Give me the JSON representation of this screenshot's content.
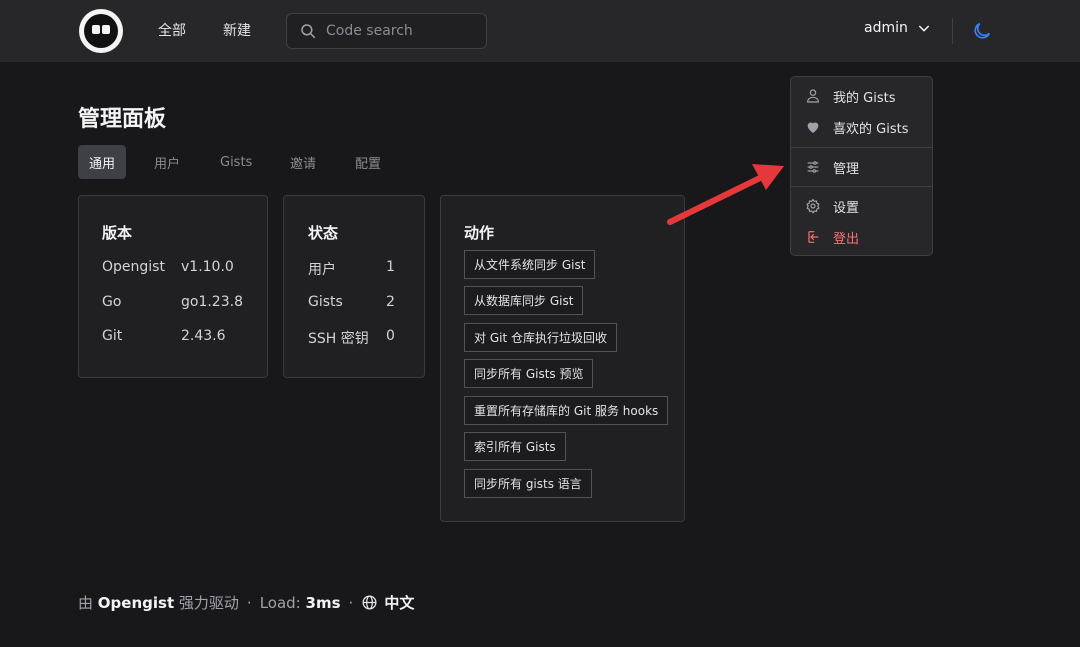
{
  "header": {
    "nav": [
      "全部",
      "新建"
    ],
    "search_placeholder": "Code search",
    "username": "admin"
  },
  "page": {
    "title": "管理面板",
    "tabs": [
      "通用",
      "用户",
      "Gists",
      "邀请",
      "配置"
    ]
  },
  "version_card": {
    "title": "版本",
    "rows": [
      {
        "label": "Opengist",
        "value": "v1.10.0"
      },
      {
        "label": "Go",
        "value": "go1.23.8"
      },
      {
        "label": "Git",
        "value": "2.43.6"
      }
    ]
  },
  "status_card": {
    "title": "状态",
    "rows": [
      {
        "label": "用户",
        "value": "1"
      },
      {
        "label": "Gists",
        "value": "2"
      },
      {
        "label": "SSH 密钥",
        "value": "0"
      }
    ]
  },
  "actions_card": {
    "title": "动作",
    "buttons": [
      "从文件系统同步 Gist",
      "从数据库同步 Gist",
      "对 Git 仓库执行垃圾回收",
      "同步所有 Gists 预览",
      "重置所有存储库的 Git 服务 hooks",
      "索引所有 Gists",
      "同步所有 gists 语言"
    ]
  },
  "user_menu": {
    "items": [
      "我的 Gists",
      "喜欢的 Gists",
      "管理",
      "设置",
      "登出"
    ],
    "icons": [
      "user-icon",
      "heart-icon",
      "sliders-icon",
      "gear-icon",
      "logout-icon"
    ]
  },
  "footer": {
    "prefix": "由",
    "brand": "Opengist",
    "suffix": "强力驱动",
    "load_label": "Load:",
    "load_value": "3ms",
    "language": "中文"
  },
  "colors": {
    "background": "#18181b",
    "topbar": "#27272a",
    "card": "#202023",
    "danger": "#f87171",
    "moon": "#3b82f6",
    "annotation_arrow": "#e5383b"
  }
}
